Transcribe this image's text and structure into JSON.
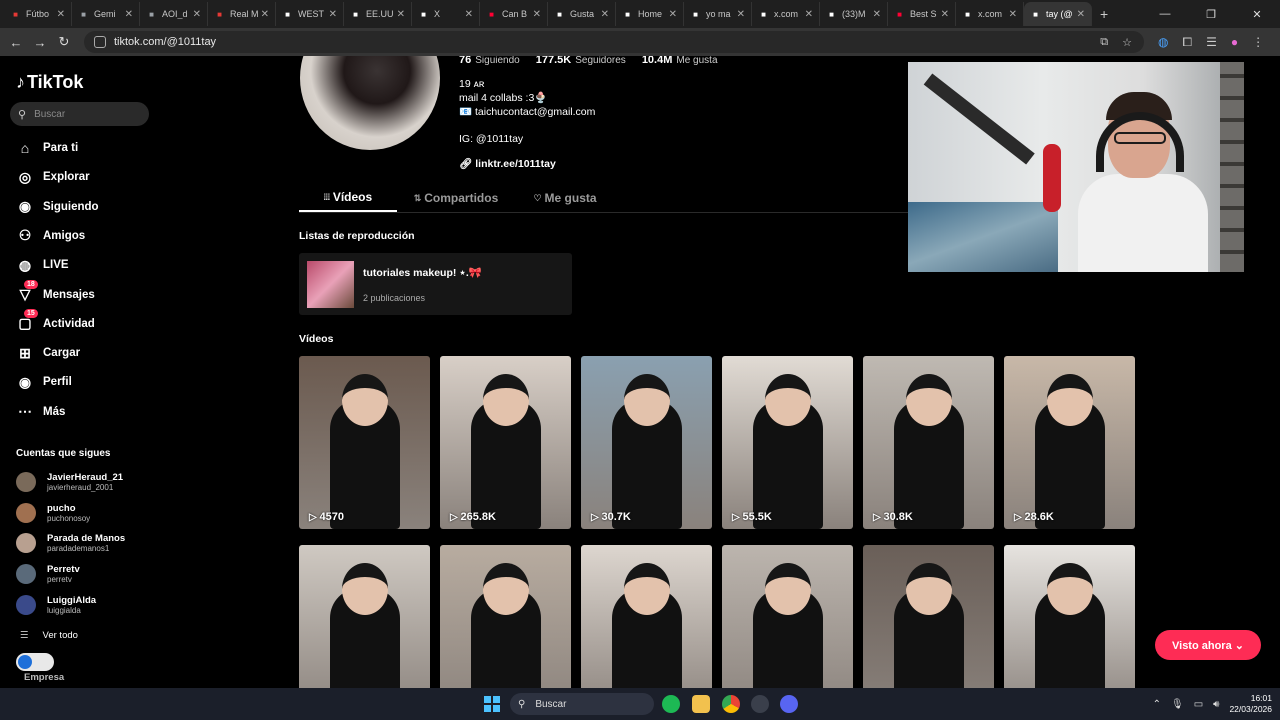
{
  "browser": {
    "tabs": [
      {
        "label": "Fútbo",
        "icon": "red-bookmark-icon",
        "color": "#e53935",
        "active": false
      },
      {
        "label": "Gemi",
        "icon": "globe-icon",
        "color": "#9aa0a6",
        "active": false
      },
      {
        "label": "AOI_d",
        "icon": "globe-icon",
        "color": "#9aa0a6",
        "active": false
      },
      {
        "label": "Real M",
        "icon": "red-bookmark-icon",
        "color": "#e53935",
        "active": false
      },
      {
        "label": "WEST",
        "icon": "x-icon",
        "color": "#ffffff",
        "active": false
      },
      {
        "label": "EE.UU",
        "icon": "news-icon",
        "color": "#ffffff",
        "active": false
      },
      {
        "label": "X",
        "icon": "x-icon",
        "color": "#ffffff",
        "active": false
      },
      {
        "label": "Can B",
        "icon": "youtube-icon",
        "color": "#ff0033",
        "active": false
      },
      {
        "label": "Gusta",
        "icon": "news-icon",
        "color": "#ffffff",
        "active": false
      },
      {
        "label": "Home",
        "icon": "x-icon",
        "color": "#ffffff",
        "active": false
      },
      {
        "label": "yo ma",
        "icon": "tiktok-icon",
        "color": "#ffffff",
        "active": false
      },
      {
        "label": "x.com",
        "icon": "x-icon",
        "color": "#ffffff",
        "active": false
      },
      {
        "label": "(33)M",
        "icon": "tiktok-icon",
        "color": "#ffffff",
        "active": false
      },
      {
        "label": "Best S",
        "icon": "youtube-icon",
        "color": "#ff0033",
        "active": false
      },
      {
        "label": "x.com",
        "icon": "x-icon",
        "color": "#ffffff",
        "active": false
      },
      {
        "label": "tay (@",
        "icon": "tiktok-icon",
        "color": "#ffffff",
        "active": true
      }
    ],
    "new_tab": "+",
    "url": "tiktok.com/@1011tay"
  },
  "sidebar": {
    "logo": "TikTok",
    "search_placeholder": "Buscar",
    "nav": [
      {
        "label": "Para ti",
        "icon": "home-icon"
      },
      {
        "label": "Explorar",
        "icon": "compass-icon"
      },
      {
        "label": "Siguiendo",
        "icon": "following-avatar-icon"
      },
      {
        "label": "Amigos",
        "icon": "friends-icon"
      },
      {
        "label": "LIVE",
        "icon": "live-icon"
      },
      {
        "label": "Mensajes",
        "icon": "messages-icon",
        "badge": "18"
      },
      {
        "label": "Actividad",
        "icon": "activity-icon",
        "badge": "15"
      },
      {
        "label": "Cargar",
        "icon": "upload-icon"
      },
      {
        "label": "Perfil",
        "icon": "profile-avatar-icon"
      },
      {
        "label": "Más",
        "icon": "more-icon"
      }
    ],
    "follows_title": "Cuentas que sigues",
    "follows": [
      {
        "name": "JavierHeraud_21",
        "handle": "javierheraud_2001"
      },
      {
        "name": "pucho",
        "handle": "puchonosoy"
      },
      {
        "name": "Parada de Manos",
        "handle": "paradademanos1"
      },
      {
        "name": "Perretv",
        "handle": "perretv"
      },
      {
        "name": "LuiggiAlda",
        "handle": "luiggialda"
      }
    ],
    "see_all": "Ver todo",
    "business": "Empresa"
  },
  "profile": {
    "stats": [
      {
        "value": "76",
        "label": "Siguiendo"
      },
      {
        "value": "177.5K",
        "label": "Seguidores"
      },
      {
        "value": "10.4M",
        "label": "Me gusta"
      }
    ],
    "bio_lines": [
      "19 ᴀʀ",
      "mail 4 collabs :3🍨",
      "📧 taichucontact@gmail.com",
      "",
      "IG: @1011tay"
    ],
    "link": "linktr.ee/1011tay",
    "tabs": [
      {
        "label": "Vídeos",
        "icon": "grid-icon",
        "active": true
      },
      {
        "label": "Compartidos",
        "icon": "repost-icon",
        "active": false
      },
      {
        "label": "Me gusta",
        "icon": "heart-outline-icon",
        "active": false
      }
    ],
    "playlists_title": "Listas de reproducción",
    "playlist": {
      "title": "tutoriales makeup! ⋆.🎀",
      "count": "2 publicaciones"
    },
    "videos_title": "Vídeos",
    "videos": [
      "4570",
      "265.8K",
      "30.7K",
      "55.5K",
      "30.8K",
      "28.6K",
      "",
      "",
      "",
      "",
      "",
      ""
    ]
  },
  "visto_button": "Visto ahora ⌄",
  "taskbar": {
    "search_placeholder": "Buscar",
    "time": "16:01",
    "date": "22/03/2026"
  }
}
